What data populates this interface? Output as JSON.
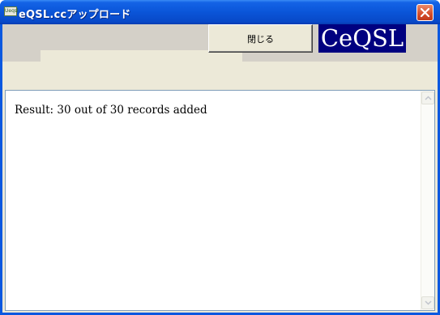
{
  "window": {
    "title": "eQSL.ccアップロード",
    "app_icon_text": "Ueqsl",
    "close_icon": "close-icon"
  },
  "toolbar": {
    "close_label": "閉じる",
    "logo_text": "CeQSL"
  },
  "output": {
    "result_text": "Result: 30 out of 30 records added"
  },
  "colors": {
    "titlebar": "#0a55d8",
    "logo_bg": "#000080",
    "client_bg": "#ece9d8",
    "strip_bg": "#d4d0c8"
  }
}
